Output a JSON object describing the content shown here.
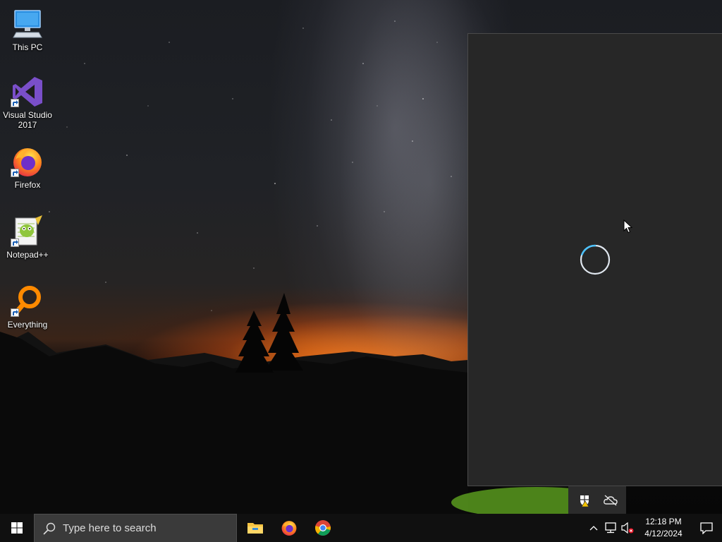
{
  "desktop": {
    "icons": [
      {
        "label": "This PC",
        "icon": "monitor-icon"
      },
      {
        "label": "Visual Studio\n2017",
        "icon": "visual-studio-icon"
      },
      {
        "label": "Firefox",
        "icon": "firefox-icon"
      },
      {
        "label": "Notepad++",
        "icon": "notepadplusplus-icon"
      },
      {
        "label": "Everything",
        "icon": "everything-search-icon"
      }
    ]
  },
  "flyout": {
    "state": "loading",
    "spinner_icon": "loading-spinner-icon"
  },
  "tray_overflow": {
    "icons": [
      "defender-shield-warning-icon",
      "onedrive-offline-icon"
    ]
  },
  "taskbar": {
    "start_icon": "windows-logo-icon",
    "search": {
      "placeholder": "Type here to search",
      "icon": "search-icon"
    },
    "apps": [
      {
        "name": "File Explorer",
        "icon": "file-explorer-icon"
      },
      {
        "name": "Firefox",
        "icon": "firefox-icon"
      },
      {
        "name": "Google Chrome",
        "icon": "chrome-icon"
      }
    ],
    "tray": {
      "icons": [
        "chevron-up-icon",
        "network-icon",
        "volume-muted-icon"
      ],
      "time": "12:18 PM",
      "date": "4/12/2024",
      "notification_icon": "action-center-icon"
    }
  },
  "colors": {
    "taskbar_bg": "#101010",
    "flyout_bg": "#272727",
    "accent_spinner": "#4cc2ff",
    "sunset_orange": "#f6761a"
  }
}
